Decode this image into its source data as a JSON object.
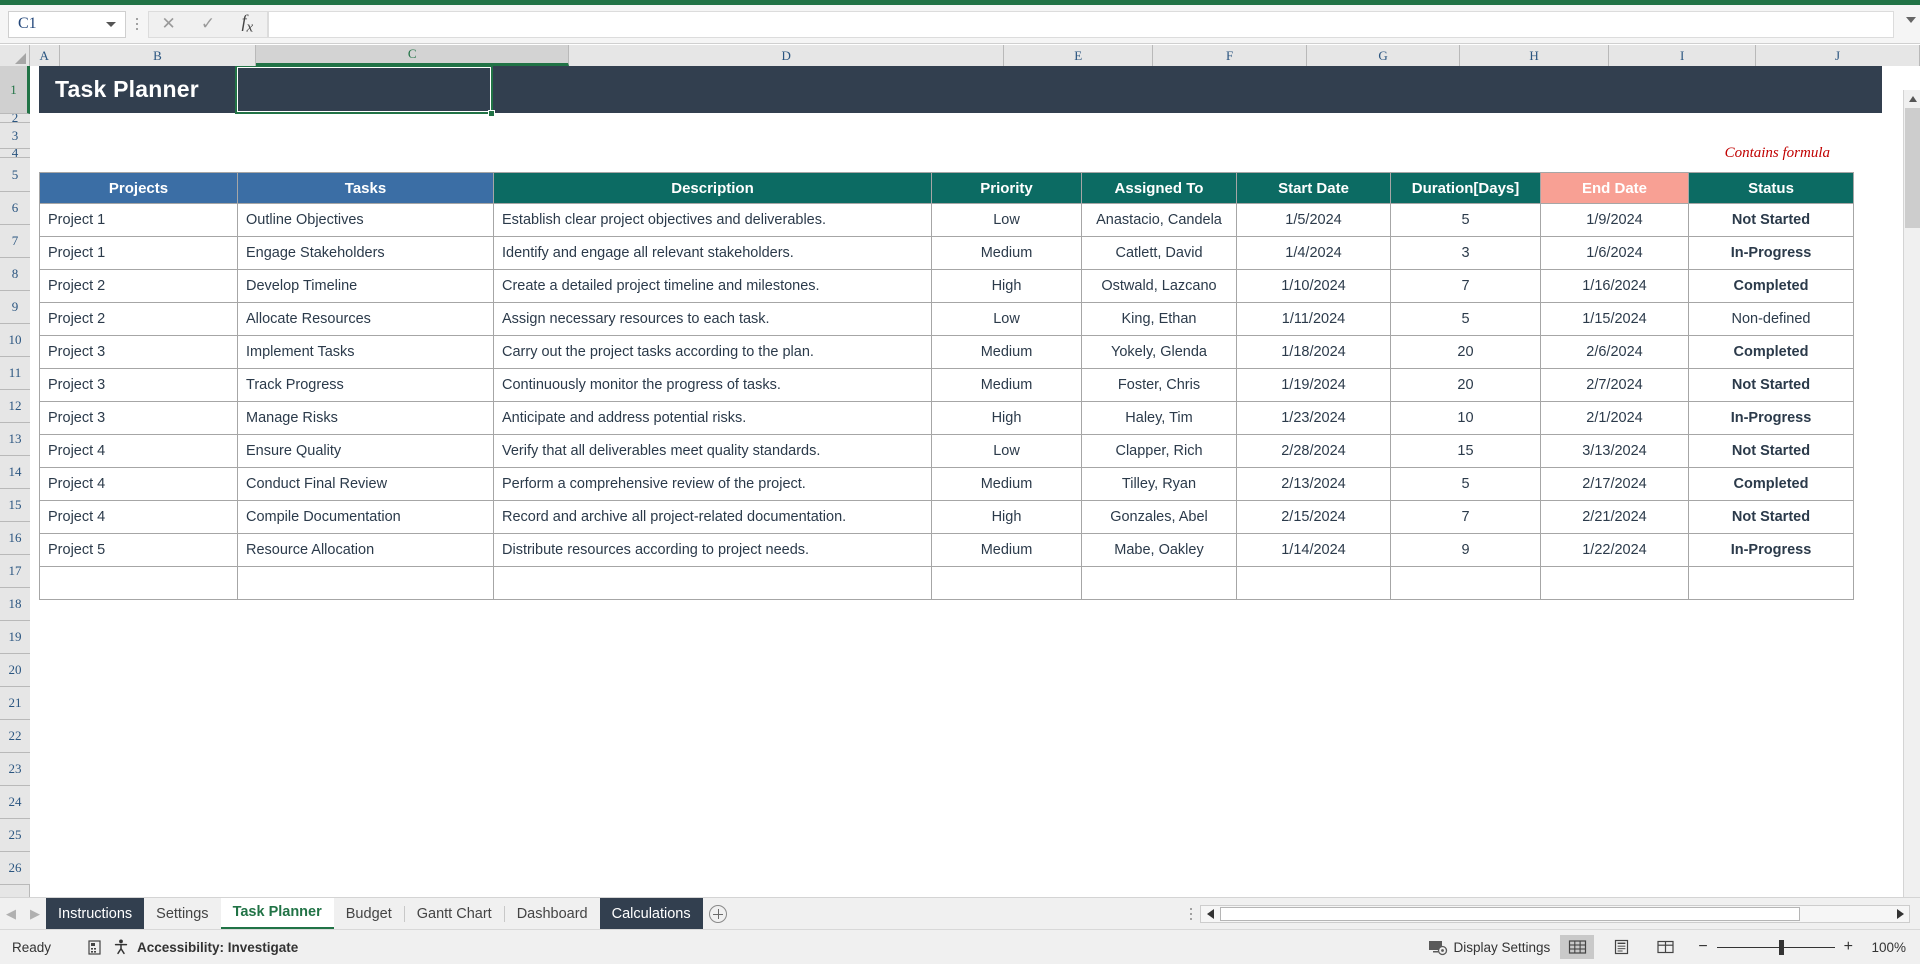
{
  "formula_bar": {
    "name_box_value": "C1",
    "formula_value": "",
    "cancel_icon": "close-icon",
    "enter_icon": "check-icon",
    "function_icon": "fx-icon"
  },
  "grid": {
    "column_headers": [
      "A",
      "B",
      "C",
      "D",
      "E",
      "F",
      "G",
      "H",
      "I",
      "J"
    ],
    "selected_column": "C",
    "selected_row": "1",
    "row_headers": [
      "1",
      "2",
      "3",
      "4",
      "5",
      "6",
      "7",
      "8",
      "9",
      "10",
      "11",
      "12",
      "13",
      "14",
      "15",
      "16",
      "17",
      "18",
      "19",
      "20",
      "21",
      "22",
      "23",
      "24",
      "25",
      "26"
    ]
  },
  "banner": {
    "title": "Task Planner",
    "background_color": "#323f4f"
  },
  "note": {
    "formula_note": "Contains formula",
    "color": "#c00000"
  },
  "table": {
    "headers": [
      {
        "label": "Projects",
        "color": "#3b6ea5"
      },
      {
        "label": "Tasks",
        "color": "#3b6ea5"
      },
      {
        "label": "Description",
        "color": "#0c6b63"
      },
      {
        "label": "Priority",
        "color": "#0c6b63"
      },
      {
        "label": "Assigned To",
        "color": "#0c6b63"
      },
      {
        "label": "Start Date",
        "color": "#0c6b63"
      },
      {
        "label": "Duration[Days]",
        "color": "#0c6b63"
      },
      {
        "label": "End Date",
        "color": "#f8a094"
      },
      {
        "label": "Status",
        "color": "#0c6b63"
      }
    ],
    "rows": [
      {
        "project": "Project 1",
        "task": "Outline Objectives",
        "description": "Establish clear project objectives and deliverables.",
        "priority": "Low",
        "assigned_to": "Anastacio, Candela",
        "start_date": "1/5/2024",
        "duration": "5",
        "end_date": "1/9/2024",
        "status": "Not Started",
        "status_class": "st-notstarted"
      },
      {
        "project": "Project 1",
        "task": "Engage Stakeholders",
        "description": "Identify and engage all relevant stakeholders.",
        "priority": "Medium",
        "assigned_to": "Catlett, David",
        "start_date": "1/4/2024",
        "duration": "3",
        "end_date": "1/6/2024",
        "status": "In-Progress",
        "status_class": "st-inprogress"
      },
      {
        "project": "Project 2",
        "task": "Develop Timeline",
        "description": "Create a detailed project timeline and milestones.",
        "priority": "High",
        "assigned_to": "Ostwald, Lazcano",
        "start_date": "1/10/2024",
        "duration": "7",
        "end_date": "1/16/2024",
        "status": "Completed",
        "status_class": "st-completed"
      },
      {
        "project": "Project 2",
        "task": "Allocate Resources",
        "description": "Assign necessary resources to each task.",
        "priority": "Low",
        "assigned_to": "King, Ethan",
        "start_date": "1/11/2024",
        "duration": "5",
        "end_date": "1/15/2024",
        "status": "Non-defined",
        "status_class": "st-nondefined"
      },
      {
        "project": "Project 3",
        "task": "Implement Tasks",
        "description": "Carry out the project tasks according to the plan.",
        "priority": "Medium",
        "assigned_to": "Yokely, Glenda",
        "start_date": "1/18/2024",
        "duration": "20",
        "end_date": "2/6/2024",
        "status": "Completed",
        "status_class": "st-completed"
      },
      {
        "project": "Project 3",
        "task": "Track Progress",
        "description": "Continuously monitor the progress of tasks.",
        "priority": "Medium",
        "assigned_to": "Foster, Chris",
        "start_date": "1/19/2024",
        "duration": "20",
        "end_date": "2/7/2024",
        "status": "Not Started",
        "status_class": "st-notstarted"
      },
      {
        "project": "Project 3",
        "task": "Manage Risks",
        "description": "Anticipate and address potential risks.",
        "priority": "High",
        "assigned_to": "Haley, Tim",
        "start_date": "1/23/2024",
        "duration": "10",
        "end_date": "2/1/2024",
        "status": "In-Progress",
        "status_class": "st-inprogress"
      },
      {
        "project": "Project 4",
        "task": "Ensure Quality",
        "description": "Verify that all deliverables meet quality standards.",
        "priority": "Low",
        "assigned_to": "Clapper, Rich",
        "start_date": "2/28/2024",
        "duration": "15",
        "end_date": "3/13/2024",
        "status": "Not Started",
        "status_class": "st-notstarted"
      },
      {
        "project": "Project 4",
        "task": "Conduct Final Review",
        "description": "Perform a comprehensive review of the project.",
        "priority": "Medium",
        "assigned_to": "Tilley, Ryan",
        "start_date": "2/13/2024",
        "duration": "5",
        "end_date": "2/17/2024",
        "status": "Completed",
        "status_class": "st-completed"
      },
      {
        "project": "Project 4",
        "task": "Compile Documentation",
        "description": "Record and archive all project-related documentation.",
        "priority": "High",
        "assigned_to": "Gonzales, Abel",
        "start_date": "2/15/2024",
        "duration": "7",
        "end_date": "2/21/2024",
        "status": "Not Started",
        "status_class": "st-notstarted"
      },
      {
        "project": "Project 5",
        "task": "Resource Allocation",
        "description": "Distribute resources according to project needs.",
        "priority": "Medium",
        "assigned_to": "Mabe, Oakley",
        "start_date": "1/14/2024",
        "duration": "9",
        "end_date": "1/22/2024",
        "status": "In-Progress",
        "status_class": "st-inprogress"
      }
    ]
  },
  "sheet_tabs": {
    "tabs": [
      {
        "label": "Instructions",
        "state": "colored"
      },
      {
        "label": "Settings",
        "state": "normal"
      },
      {
        "label": "Task Planner",
        "state": "active"
      },
      {
        "label": "Budget",
        "state": "normal"
      },
      {
        "label": "Gantt Chart",
        "state": "normal"
      },
      {
        "label": "Dashboard",
        "state": "normal"
      },
      {
        "label": "Calculations",
        "state": "colored"
      }
    ],
    "add_sheet_icon": "plus-circle-icon"
  },
  "status_bar": {
    "ready_label": "Ready",
    "accessibility_label": "Accessibility: Investigate",
    "display_settings_label": "Display Settings",
    "zoom_level": "100%",
    "normal_view_icon": "grid-view-icon",
    "page_layout_icon": "page-layout-icon",
    "page_break_icon": "page-break-icon",
    "zoom_out_icon": "minus-icon",
    "zoom_in_icon": "plus-icon"
  }
}
